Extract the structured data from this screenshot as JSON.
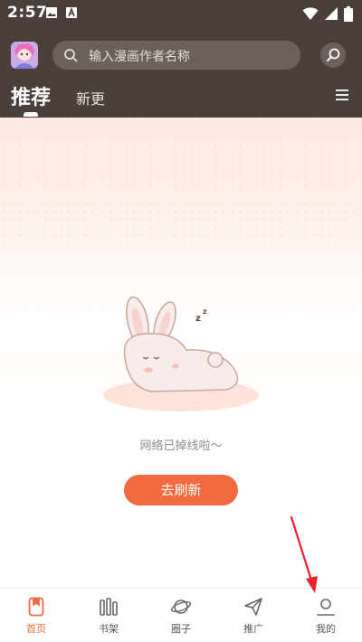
{
  "status_bar": {
    "time": "2:57"
  },
  "search": {
    "placeholder": "输入漫画作者名称"
  },
  "tabs": [
    {
      "label": "推荐",
      "active": true
    },
    {
      "label": "新更",
      "active": false
    }
  ],
  "content": {
    "offline_message": "网络已掉线啦～",
    "refresh_label": "去刷新"
  },
  "bottom_nav": [
    {
      "label": "首页",
      "icon": "bookmark-icon",
      "active": true
    },
    {
      "label": "书架",
      "icon": "bookshelf-icon",
      "active": false
    },
    {
      "label": "圈子",
      "icon": "planet-icon",
      "active": false
    },
    {
      "label": "推广",
      "icon": "paper-plane-icon",
      "active": false
    },
    {
      "label": "我的",
      "icon": "user-icon",
      "active": false
    }
  ],
  "colors": {
    "header_bg": "#4a3f3b",
    "accent": "#f26a3d",
    "annotation_arrow": "#e8232a"
  }
}
